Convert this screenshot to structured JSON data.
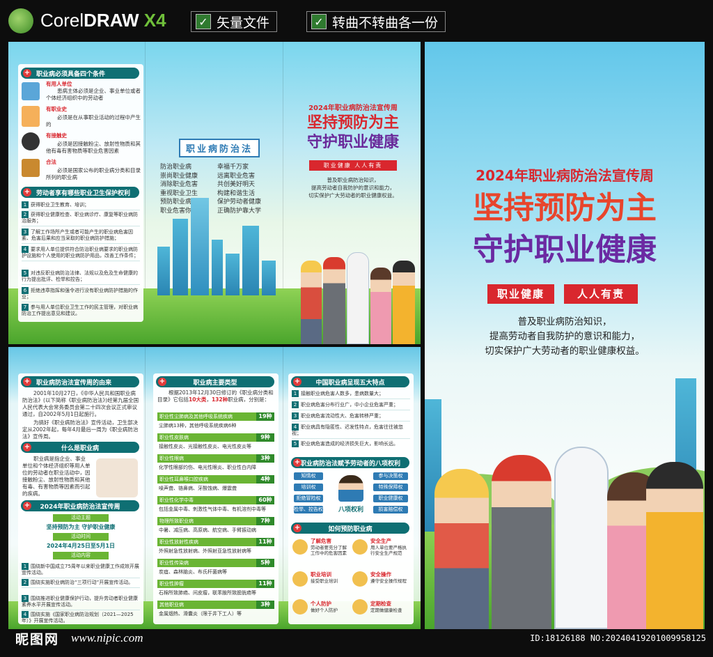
{
  "topbar": {
    "logo_word1": "Corel",
    "logo_word2": "DRAW",
    "logo_word3": " X4",
    "tag1": "矢量文件",
    "tag2": "转曲不转曲各一份"
  },
  "conditions": {
    "title": "职业病必须具备四个条件",
    "items": [
      {
        "head": "有用人单位",
        "body": "患病主体必须是企业、事业单位或者个体经济组织中的劳动者"
      },
      {
        "head": "有职业史",
        "body": "必须是在从事职业活动的过程中产生的"
      },
      {
        "head": "有接触史",
        "body": "必须是因接触粉尘、放射性物质和其他有毒有害物质等职业危害因素"
      },
      {
        "head": "合法",
        "body": "必须是国家公布的职业病分类和目录所列的职业病"
      }
    ]
  },
  "rights": {
    "title": "劳动者享有哪些职业卫生保护权利",
    "items": [
      "获得职业卫生教育、培训；",
      "获得职业健康检查、职业病诊疗、康复等职业病防治服务；",
      "了解工作场所产生或者可能产生的职业病危害因素、危害后果和应当采取的职业病防护措施；",
      "要求用人单位提供符合防治职业病要求的职业病防护设施和个人使用的职业病防护用品，改善工作条件；",
      "对违反职业病防治法律、法规以及危及生命健康的行为提出批评、检举和控告；",
      "拒绝违章指挥和强令进行没有职业病防护措施的作业；",
      "参与用人单位职业卫生工作的民主管理，对职业病防治工作提出意见和建议。"
    ]
  },
  "poem": {
    "title": "职业病防治法",
    "col1": [
      "防治职业病",
      "崇尚职业健康",
      "消除职业危害",
      "重视职业卫生",
      "预防职业病危害",
      "职业危害你我他"
    ],
    "col2": [
      "幸福千万家",
      "远离职业危害",
      "共创美好明天",
      "构建和谐生活",
      "保护劳动者健康",
      "正确防护靠大学"
    ]
  },
  "cover_small": {
    "week": "2024年职业病防治法宣传周",
    "line1": "坚持预防为主",
    "line2": "守护职业健康",
    "slogan": "职业健康  人人有责",
    "desc1": "普及职业病防治知识，",
    "desc2": "提高劳动者自我防护的意识和能力，",
    "desc3": "切实保护广大劳动者的职业健康权益。"
  },
  "cover_big": {
    "week": "2024年职业病防治法宣传周",
    "line1": "坚持预防为主",
    "line2": "守护职业健康",
    "slogan1": "职业健康",
    "slogan2": "人人有责",
    "desc1": "普及职业病防治知识，",
    "desc2": "提高劳动者自我防护的意识和能力，",
    "desc3": "切实保护广大劳动者的职业健康权益。"
  },
  "origin": {
    "title": "职业病防治法宣传周的由来",
    "p1": "2001年10月27日，《中华人民共和国职业病防治法》(以下简称《职业病防治法》)经第九届全国人民代表大会常务委员会第二十四次会议正式审议通过，自2002年5月1日起施行。",
    "p2": "为搞好《职业病防治法》宣传活动，卫生部决定从2002年起，每年4月最后一周为《职业病防治法》宣传周。"
  },
  "what": {
    "title": "什么是职业病",
    "body": "职业病是指企业、事业单位和个体经济组织等用人单位的劳动者在职业活动中，因接触粉尘、放射性物质和其他有毒、有害物质等因素而引起的疾病。"
  },
  "week2024": {
    "title": "2024年职业病防治法宣传周",
    "theme_label": "活动主题",
    "theme": "坚持预防为主  守护职业健康",
    "time_label": "活动时间",
    "time": "2024年4月25日至5月1日",
    "content_label": "活动内容",
    "items": [
      "围绕新中国成立75周年以来职业健康工作成效开展宣传活动。",
      "围绕实施职业病防治“三项行动”开展宣传活动。",
      "围绕推进职业健康保护行动，提升劳动者职业健康素养水平开展宣传活动。",
      "围绕实施《国家职业病防治规划（2021—2025年）》开展宣传活动。"
    ]
  },
  "types": {
    "title": "职业病主要类型",
    "intro": "根据2013年12月30日修订的《职业病分类和目录》它包括10大类，132种职业病，分别是：",
    "intro_a": "根据2013年12月30日修订的《职业病分类和目录》它包括",
    "intro_b": "10大类",
    "intro_c": "，",
    "intro_d": "132种",
    "intro_e": "职业病，分别是：",
    "items": [
      {
        "name": "职业性尘肺病及其他呼吸系统疾病",
        "count": "19种",
        "desc": "尘肺病13种，其他呼吸系统疾病6种"
      },
      {
        "name": "职业性皮肤病",
        "count": "9种",
        "desc": "接触性皮炎、光接触性皮炎、电光性皮炎等"
      },
      {
        "name": "职业性眼病",
        "count": "3种",
        "desc": "化学性眼部灼伤、电光性眼炎、职业性白内障"
      },
      {
        "name": "职业性耳鼻喉口腔疾病",
        "count": "4种",
        "desc": "噪声聋、铬鼻病、牙酸蚀病、爆震聋"
      },
      {
        "name": "职业性化学中毒",
        "count": "60种",
        "desc": "包括金属中毒、刺激性气体中毒、有机溶剂中毒等"
      },
      {
        "name": "物理所致职业病",
        "count": "7种",
        "desc": "中暑、减压病、高原病、航空病、手臂振动病"
      },
      {
        "name": "职业性放射性疾病",
        "count": "11种",
        "desc": "外照射急性放射病、外照射亚急性放射病等"
      },
      {
        "name": "职业性传染病",
        "count": "5种",
        "desc": "炭疽、森林脑炎、布氏杆菌病等"
      },
      {
        "name": "职业性肿瘤",
        "count": "11种",
        "desc": "石棉所致肺癌、间皮瘤，联苯胺所致膀胱癌等"
      },
      {
        "name": "其他职业病",
        "count": "3种",
        "desc": "金属烟热、滑囊炎（限于井下工人）等"
      }
    ]
  },
  "features": {
    "title": "中国职业病呈现五大特点",
    "items": [
      "接触职业病危害人数多，患病数量大；",
      "职业病危害分布行业广，中小企业危害严重；",
      "职业病危害流动性大、危害转移严重；",
      "职业病具有隐匿性、迟发性特点，危害往往被忽视；",
      "职业病危害造成的经济损失巨大，影响长远。"
    ]
  },
  "eight": {
    "title": "职业病防治法赋予劳动者的八项权利",
    "left": [
      "知情权",
      "培训权",
      "拒绝冒险权",
      "检举、控告权"
    ],
    "right": [
      "参与决策权",
      "特殊保障权",
      "职业健康权",
      "损害赔偿权"
    ],
    "center": "八项权利"
  },
  "prevent": {
    "title": "如何预防职业病",
    "items": [
      {
        "head": "了解危害",
        "body": "劳动者要充分了解工作中的危害因素"
      },
      {
        "head": "安全生产",
        "body": "用人单位要严格执行安全生产规范"
      },
      {
        "head": "职业培训",
        "body": "接受职业培训"
      },
      {
        "head": "安全操作",
        "body": "遵守安全操作规程"
      },
      {
        "head": "个人防护",
        "body": "做好个人防护"
      },
      {
        "head": "定期检查",
        "body": "定期做健康检查"
      }
    ]
  },
  "watermark": {
    "site_cn": "昵图网",
    "site_url": "www.nipic.com",
    "id": "ID:18126188 NO:20240419201009958125"
  },
  "colors": {
    "teal": "#0f6f73",
    "red": "#d9272e",
    "green": "#6ab534",
    "blue": "#2e7bb4"
  }
}
